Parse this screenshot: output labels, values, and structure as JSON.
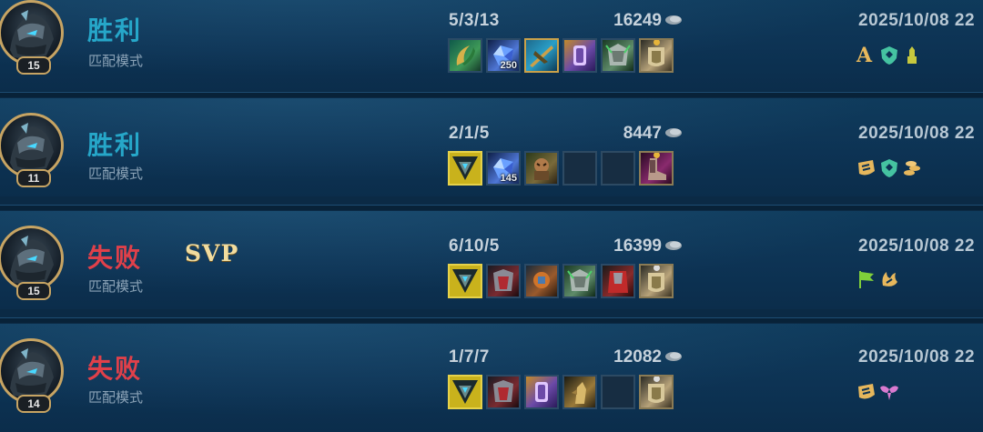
{
  "matches": [
    {
      "level": "15",
      "result": "胜利",
      "result_type": "win",
      "mode": "匹配模式",
      "svp": "",
      "kda": "5/3/13",
      "gold": "16249",
      "date": "2025/10/08 22",
      "items": [
        {
          "icon": "sword-tooth-icon",
          "color": "#3f9a58",
          "count": ""
        },
        {
          "icon": "blue-crystal-icon",
          "color": "#4f77d6",
          "count": "250"
        },
        {
          "icon": "gold-crossbow-icon",
          "color": "#b48a34",
          "count": ""
        },
        {
          "icon": "purple-banner-icon",
          "color": "#6c4aa8",
          "count": ""
        },
        {
          "icon": "green-armor-icon",
          "color": "#5f8c6a",
          "count": ""
        },
        {
          "icon": "gold-armor-trinket-icon",
          "color": "#b8a37a",
          "count": "",
          "trinket_dot": "#e6b43a"
        }
      ],
      "badges": [
        {
          "type": "letter",
          "text": "A",
          "color": "#e6b75c"
        },
        {
          "type": "icon",
          "icon": "shield-diamond-icon",
          "color": "#45c3a1"
        },
        {
          "type": "icon",
          "icon": "tower-icon",
          "color": "#c7c83e"
        }
      ]
    },
    {
      "level": "11",
      "result": "胜利",
      "result_type": "win",
      "mode": "匹配模式",
      "svp": "",
      "kda": "2/1/5",
      "gold": "8447",
      "date": "2025/10/08 22",
      "items": [
        {
          "icon": "yellow-triangle-emblem-icon",
          "color": "#c9b21c",
          "count": ""
        },
        {
          "icon": "blue-crystal-icon",
          "color": "#4f77d6",
          "count": "145"
        },
        {
          "icon": "orc-warrior-icon",
          "color": "#7a6a3a",
          "count": ""
        },
        {
          "icon": "empty-slot",
          "color": "",
          "count": ""
        },
        {
          "icon": "empty-slot",
          "color": "",
          "count": ""
        },
        {
          "icon": "boots-trinket-icon",
          "color": "#8a2a6e",
          "count": "",
          "trinket_dot": "#e6b43a"
        }
      ],
      "badges": [
        {
          "type": "icon",
          "icon": "claw-mark-icon",
          "color": "#e6b75c"
        },
        {
          "type": "icon",
          "icon": "shield-diamond-icon",
          "color": "#45c3a1"
        },
        {
          "type": "icon",
          "icon": "coin-stack-icon",
          "color": "#e6b75c"
        }
      ]
    },
    {
      "level": "15",
      "result": "失败",
      "result_type": "loss",
      "mode": "匹配模式",
      "svp": "SVP",
      "kda": "6/10/5",
      "gold": "16399",
      "date": "2025/10/08 22",
      "items": [
        {
          "icon": "yellow-triangle-emblem-icon",
          "color": "#c9b21c",
          "count": ""
        },
        {
          "icon": "red-dark-armor-icon",
          "color": "#7a2a30",
          "count": ""
        },
        {
          "icon": "orange-mech-icon",
          "color": "#9a5a2c",
          "count": ""
        },
        {
          "icon": "green-armor-icon",
          "color": "#5f8c6a",
          "count": ""
        },
        {
          "icon": "red-cape-armor-icon",
          "color": "#8a2a2a",
          "count": ""
        },
        {
          "icon": "gold-armor-trinket-icon",
          "color": "#b8a37a",
          "count": "",
          "trinket_dot": "#dddddd"
        }
      ],
      "badges": [
        {
          "type": "icon",
          "icon": "green-flag-icon",
          "color": "#7fcf3a"
        },
        {
          "type": "icon",
          "icon": "flame-claw-icon",
          "color": "#e6b75c"
        }
      ]
    },
    {
      "level": "14",
      "result": "失败",
      "result_type": "loss",
      "mode": "匹配模式",
      "svp": "",
      "kda": "1/7/7",
      "gold": "12082",
      "date": "2025/10/08 22",
      "items": [
        {
          "icon": "yellow-triangle-emblem-icon",
          "color": "#c9b21c",
          "count": ""
        },
        {
          "icon": "red-dark-armor-icon",
          "color": "#7a2a30",
          "count": ""
        },
        {
          "icon": "purple-banner-icon",
          "color": "#6c4aa8",
          "count": ""
        },
        {
          "icon": "gold-statue-icon",
          "color": "#9a7a3a",
          "count": ""
        },
        {
          "icon": "empty-slot",
          "color": "",
          "count": ""
        },
        {
          "icon": "gold-armor-trinket-icon",
          "color": "#b8a37a",
          "count": "",
          "trinket_dot": "#dddddd"
        }
      ],
      "badges": [
        {
          "type": "icon",
          "icon": "claw-mark-icon",
          "color": "#e6b75c"
        },
        {
          "type": "icon",
          "icon": "pink-wings-icon",
          "color": "#d97ad0"
        }
      ]
    }
  ]
}
